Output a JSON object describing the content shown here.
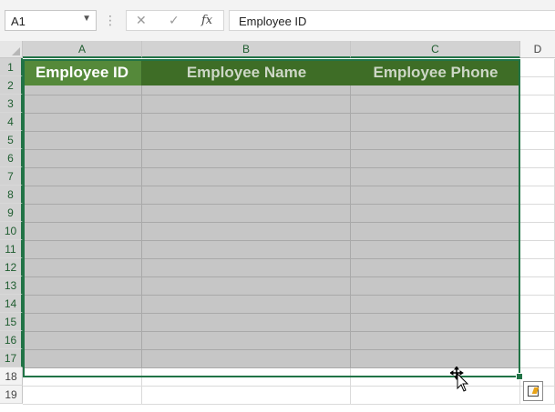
{
  "formula_bar": {
    "name_box": "A1",
    "separator": "⋮",
    "cancel_icon": "x-icon",
    "enter_icon": "check-icon",
    "function_label": "fx",
    "formula_value": "Employee ID"
  },
  "columns": [
    "A",
    "B",
    "C",
    "D"
  ],
  "rows": [
    "1",
    "2",
    "3",
    "4",
    "5",
    "6",
    "7",
    "8",
    "9",
    "10",
    "11",
    "12",
    "13",
    "14",
    "15",
    "16",
    "17",
    "18",
    "19"
  ],
  "headers": {
    "a": "Employee ID",
    "b": "Employee Name",
    "c": "Employee Phone"
  },
  "colors": {
    "selection_border": "#217346",
    "header_a_fill": "#55893a",
    "header_bc_fill": "#3e6d26",
    "selected_range_fill": "#c6c6c6"
  },
  "quick_analysis_icon": "quick-analysis-icon",
  "cursor_icon": "move-cursor-icon"
}
